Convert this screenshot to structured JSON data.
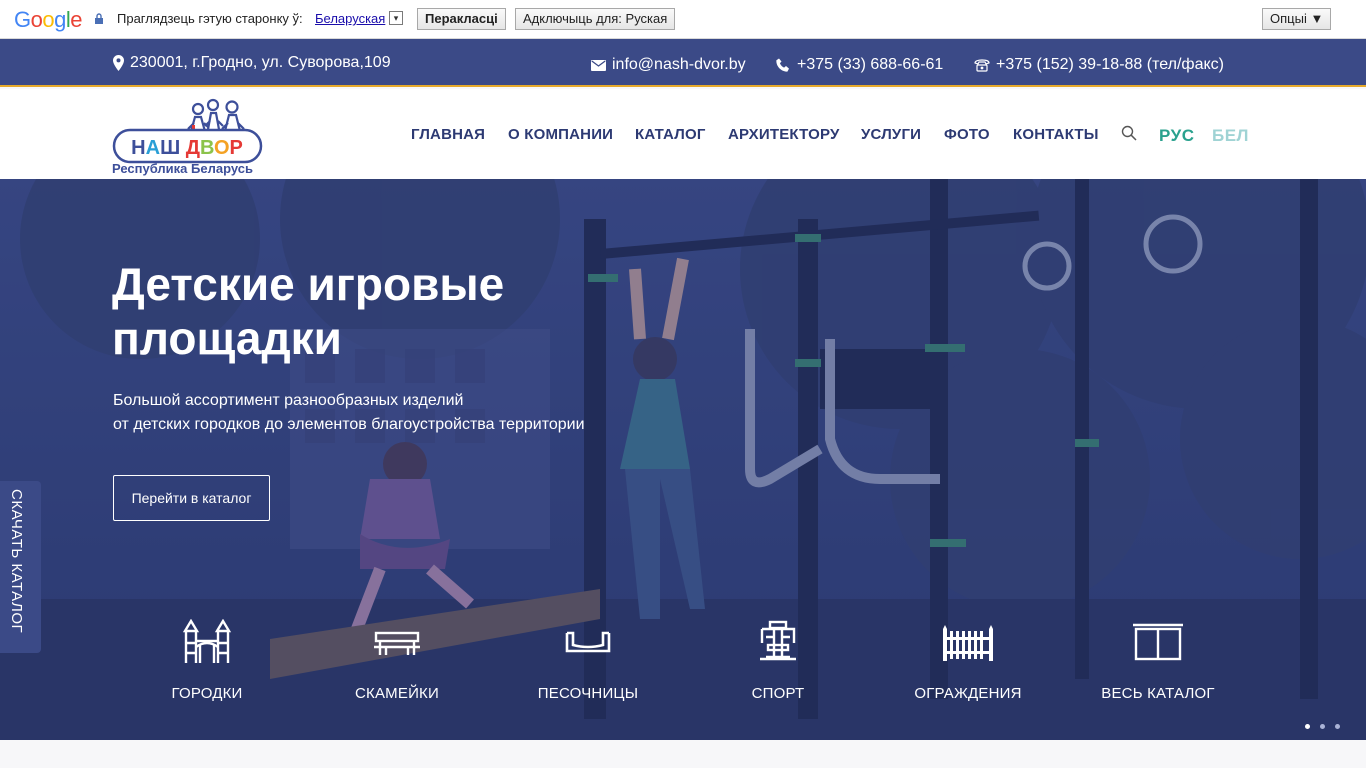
{
  "translate_bar": {
    "logo": "Google",
    "prompt": "Праглядзець гэтую старонку ў:",
    "language": "Беларуская",
    "dropdown_arrow": "▾",
    "translate_button": "Перакласці",
    "turn_off_button": "Адключыць для: Руская",
    "options_button": "Опцыі ▼"
  },
  "info_bar": {
    "address": "230001, г.Гродно, ул. Суворова,109",
    "email": "info@nash-dvor.by",
    "phone": "+375 (33) 688-66-61",
    "fax": "+375 (152) 39-18-88 (тел/факс)"
  },
  "header": {
    "logo_text": "НАШ ДВОР",
    "logo_subtitle": "Республика Беларусь",
    "nav": [
      "ГЛАВНАЯ",
      "О КОМПАНИИ",
      "КАТАЛОГ",
      "АРХИТЕКТОРУ",
      "УСЛУГИ",
      "ФОТО",
      "КОНТАКТЫ"
    ],
    "lang_ru": "РУС",
    "lang_be": "БЕЛ"
  },
  "hero": {
    "title": "Детские игровые площадки",
    "subtitle_line1": "Большой ассортимент разнообразных изделий",
    "subtitle_line2": "от детских городков до элементов благоустройства территории",
    "cta": "Перейти в каталог",
    "side_tab": "СКАЧАТЬ КАТАЛОГ",
    "categories": [
      {
        "label": "ГОРОДКИ",
        "icon": "playground-tower-icon"
      },
      {
        "label": "СКАМЕЙКИ",
        "icon": "bench-icon"
      },
      {
        "label": "ПЕСОЧНИЦЫ",
        "icon": "sandbox-icon"
      },
      {
        "label": "СПОРТ",
        "icon": "gym-machine-icon"
      },
      {
        "label": "ОГРАЖДЕНИЯ",
        "icon": "fence-icon"
      },
      {
        "label": "ВЕСЬ КАТАЛОГ",
        "icon": "catalog-icon"
      }
    ],
    "slide_count": 3,
    "active_slide": 1
  },
  "colors": {
    "brand_blue": "#3b4a87",
    "accent_orange": "#e6a92b",
    "lang_active": "#2aa18e"
  }
}
